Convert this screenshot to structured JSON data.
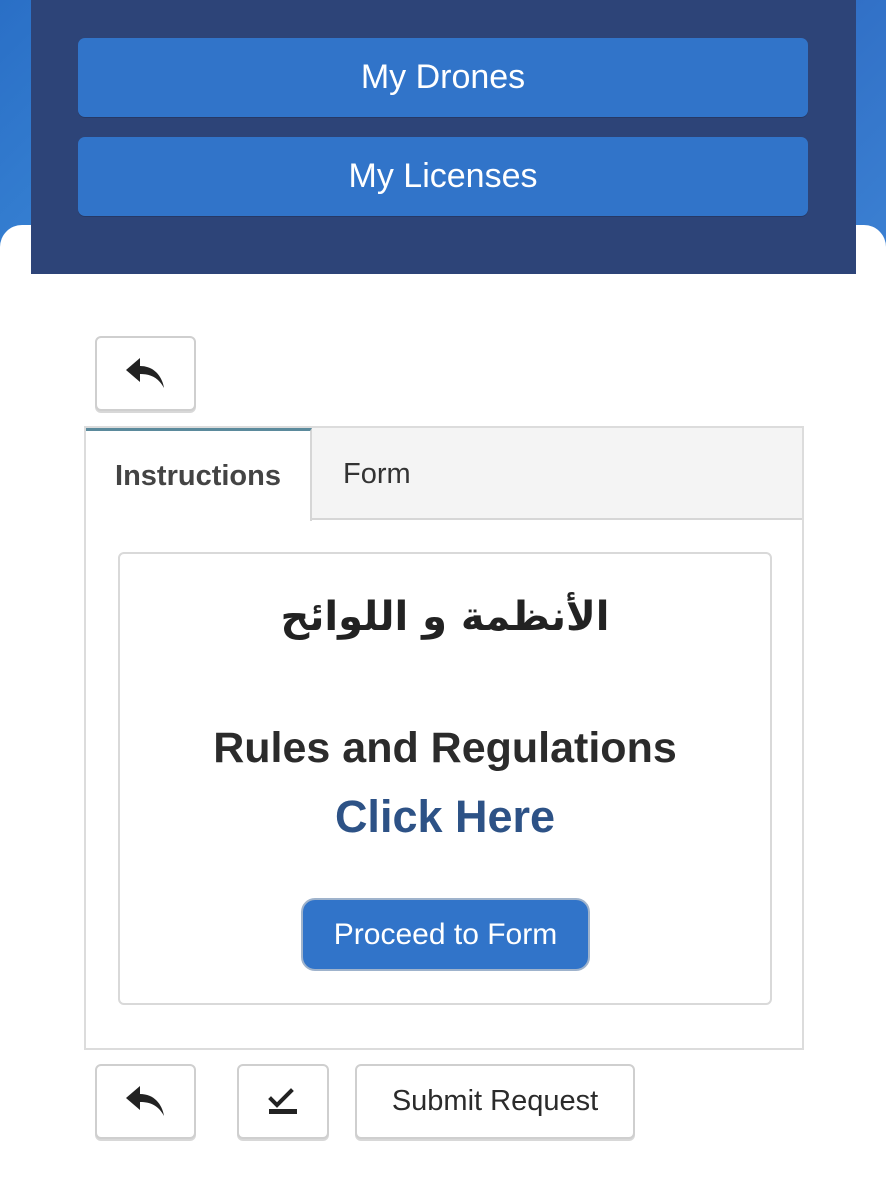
{
  "nav": {
    "my_drones": "My Drones",
    "my_licenses": "My Licenses"
  },
  "icons": {
    "back": "reply-arrow-icon",
    "check": "check-mark-icon"
  },
  "tabs": [
    {
      "label": "Instructions",
      "active": true
    },
    {
      "label": "Form",
      "active": false
    }
  ],
  "instructions": {
    "arabic_title": "الأنظمة و اللوائح",
    "title": "Rules and Regulations",
    "link_text": "Click Here",
    "proceed_label": "Proceed to Form"
  },
  "footer": {
    "submit_label": "Submit Request"
  },
  "colors": {
    "nav_panel": "#2d4478",
    "primary_button": "#3174c9",
    "link": "#2d5286",
    "active_tab_border": "#5b8a9c"
  }
}
